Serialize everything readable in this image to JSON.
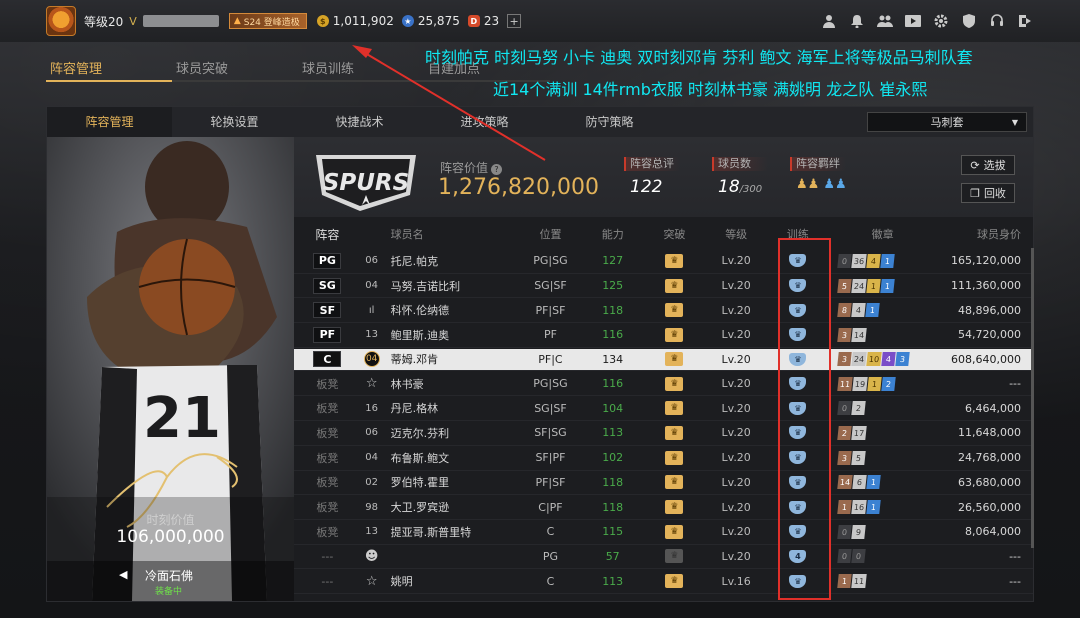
{
  "topbar": {
    "level": "等级20",
    "season": "S24 登峰造极",
    "coins": "1,011,902",
    "points": "25,875",
    "tickets": "23",
    "plus": "+"
  },
  "main_tabs": [
    "阵容管理",
    "球员突破",
    "球员训练",
    "自建加点"
  ],
  "annotation": {
    "line1": "时刻帕克 时刻马努 小卡 迪奥 双时刻邓肯 芬利 鲍文 海军上将等极品马刺队套",
    "line2": "近14个满训 14件rmb衣服 时刻林书豪 满姚明 龙之队 崔永熙"
  },
  "sub_tabs": [
    "阵容管理",
    "轮换设置",
    "快捷战术",
    "进攻策略",
    "防守策略"
  ],
  "lineup_select": "马刺套",
  "card": {
    "value_label": "时刻价值",
    "value": "106,000,000",
    "name": "冷面石佛",
    "status": "装备中",
    "jersey": "21"
  },
  "team": {
    "logo_text": "SPURS",
    "value_label": "阵容价值",
    "value": "1,276,820,000",
    "rating_label": "阵容总评",
    "rating": "122",
    "count_label": "球员数",
    "count": "18",
    "count_max": "/300",
    "bond_label": "阵容羁绊",
    "btn_select": "选拔",
    "btn_recycle": "回收"
  },
  "table": {
    "headers": [
      "阵容",
      "球员名",
      "位置",
      "能力",
      "突破",
      "等级",
      "训练",
      "徽章",
      "球员身价"
    ],
    "rows": [
      {
        "pos": "PG",
        "num": "06",
        "name": "托尼.帕克",
        "position": "PG|SG",
        "ability": "127",
        "level": "Lv.20",
        "train": "",
        "badges": [
          [
            "gray",
            "0"
          ],
          [
            "silver",
            "36"
          ],
          [
            "gold",
            "4"
          ],
          [
            "blue",
            "1"
          ]
        ],
        "value": "165,120,000"
      },
      {
        "pos": "SG",
        "num": "04",
        "name": "马努.吉诺比利",
        "position": "SG|SF",
        "ability": "125",
        "level": "Lv.20",
        "train": "",
        "badges": [
          [
            "bronze",
            "5"
          ],
          [
            "silver",
            "24"
          ],
          [
            "gold",
            "1"
          ],
          [
            "blue",
            "1"
          ]
        ],
        "value": "111,360,000"
      },
      {
        "pos": "SF",
        "num": "ıl",
        "name": "科怀.伦纳德",
        "position": "PF|SF",
        "ability": "118",
        "level": "Lv.20",
        "train": "",
        "badges": [
          [
            "bronze",
            "8"
          ],
          [
            "silver",
            "4"
          ],
          [
            "blue",
            "1"
          ]
        ],
        "value": "48,896,000"
      },
      {
        "pos": "PF",
        "num": "13",
        "name": "鲍里斯.迪奥",
        "position": "PF",
        "ability": "116",
        "level": "Lv.20",
        "train": "",
        "badges": [
          [
            "bronze",
            "3"
          ],
          [
            "silver",
            "14"
          ]
        ],
        "value": "54,720,000"
      },
      {
        "pos": "C",
        "num": "04",
        "name": "蒂姆.邓肯",
        "position": "PF|C",
        "ability": "134",
        "level": "Lv.20",
        "train": "",
        "badges": [
          [
            "bronze",
            "3"
          ],
          [
            "silver",
            "24"
          ],
          [
            "gold",
            "10"
          ],
          [
            "purple",
            "4"
          ],
          [
            "blue",
            "3"
          ]
        ],
        "value": "608,640,000",
        "highlight": true
      },
      {
        "pos": "板凳",
        "num": "★",
        "name": "林书豪",
        "position": "PG|SG",
        "ability": "116",
        "level": "Lv.20",
        "train": "",
        "badges": [
          [
            "bronze",
            "11"
          ],
          [
            "silver",
            "19"
          ],
          [
            "gold",
            "1"
          ],
          [
            "blue",
            "2"
          ]
        ],
        "value": "---"
      },
      {
        "pos": "板凳",
        "num": "16",
        "name": "丹尼.格林",
        "position": "SG|SF",
        "ability": "104",
        "level": "Lv.20",
        "train": "",
        "badges": [
          [
            "gray",
            "0"
          ],
          [
            "silver",
            "2"
          ]
        ],
        "value": "6,464,000"
      },
      {
        "pos": "板凳",
        "num": "06",
        "name": "迈克尔.芬利",
        "position": "SF|SG",
        "ability": "113",
        "level": "Lv.20",
        "train": "",
        "badges": [
          [
            "bronze",
            "2"
          ],
          [
            "silver",
            "17"
          ]
        ],
        "value": "11,648,000"
      },
      {
        "pos": "板凳",
        "num": "04",
        "name": "布鲁斯.鲍文",
        "position": "SF|PF",
        "ability": "102",
        "level": "Lv.20",
        "train": "",
        "badges": [
          [
            "bronze",
            "3"
          ],
          [
            "silver",
            "5"
          ]
        ],
        "value": "24,768,000"
      },
      {
        "pos": "板凳",
        "num": "02",
        "name": "罗伯特.霍里",
        "position": "PF|SF",
        "ability": "118",
        "level": "Lv.20",
        "train": "",
        "badges": [
          [
            "bronze",
            "14"
          ],
          [
            "silver",
            "6"
          ],
          [
            "blue",
            "1"
          ]
        ],
        "value": "63,680,000"
      },
      {
        "pos": "板凳",
        "num": "98",
        "name": "大卫.罗宾逊",
        "position": "C|PF",
        "ability": "118",
        "level": "Lv.20",
        "train": "",
        "badges": [
          [
            "bronze",
            "1"
          ],
          [
            "silver",
            "16"
          ],
          [
            "blue",
            "1"
          ]
        ],
        "value": "26,560,000"
      },
      {
        "pos": "板凳",
        "num": "13",
        "name": "提亚哥.斯普里特",
        "position": "C",
        "ability": "115",
        "level": "Lv.20",
        "train": "",
        "badges": [
          [
            "gray",
            "0"
          ],
          [
            "silver",
            "9"
          ]
        ],
        "value": "8,064,000"
      },
      {
        "pos": "---",
        "num": "☺",
        "name": "",
        "position": "PG",
        "ability": "57",
        "level": "Lv.20",
        "train": "4",
        "badges": [
          [
            "gray",
            "0"
          ],
          [
            "gray",
            "0"
          ]
        ],
        "value": "---",
        "dim": true
      },
      {
        "pos": "---",
        "num": "★",
        "name": "姚明",
        "position": "C",
        "ability": "113",
        "level": "Lv.16",
        "train": "",
        "badges": [
          [
            "bronze",
            "1"
          ],
          [
            "silver",
            "11"
          ]
        ],
        "value": "---"
      }
    ]
  }
}
